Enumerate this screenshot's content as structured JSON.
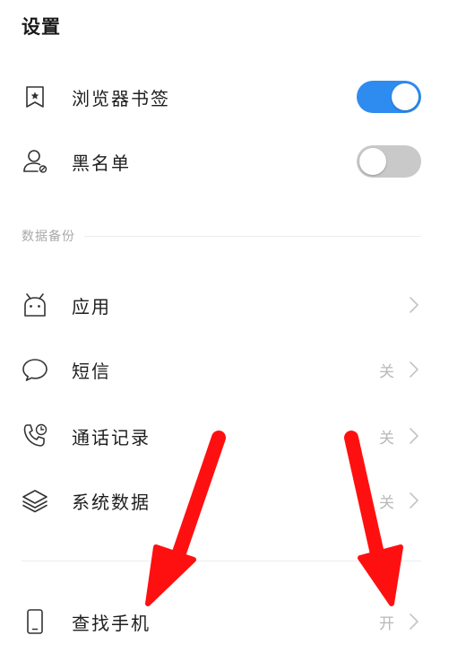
{
  "page_title": "设置",
  "rows_top": [
    {
      "label": "浏览器书签",
      "icon": "bookmark-icon",
      "toggle": "on"
    },
    {
      "label": "黑名单",
      "icon": "contact-block-icon",
      "toggle": "off"
    }
  ],
  "section_header": "数据备份",
  "backup_items": [
    {
      "label": "应用",
      "icon": "android-icon",
      "value": ""
    },
    {
      "label": "短信",
      "icon": "message-icon",
      "value": "关"
    },
    {
      "label": "通话记录",
      "icon": "call-log-icon",
      "value": "关"
    },
    {
      "label": "系统数据",
      "icon": "layers-icon",
      "value": "关"
    }
  ],
  "find_phone": {
    "label": "查找手机",
    "icon": "phone-icon",
    "value": "开"
  },
  "colors": {
    "toggle_on": "#2e8bf0",
    "toggle_off": "#c9c9c9",
    "annotation_arrow": "#ff1010"
  }
}
